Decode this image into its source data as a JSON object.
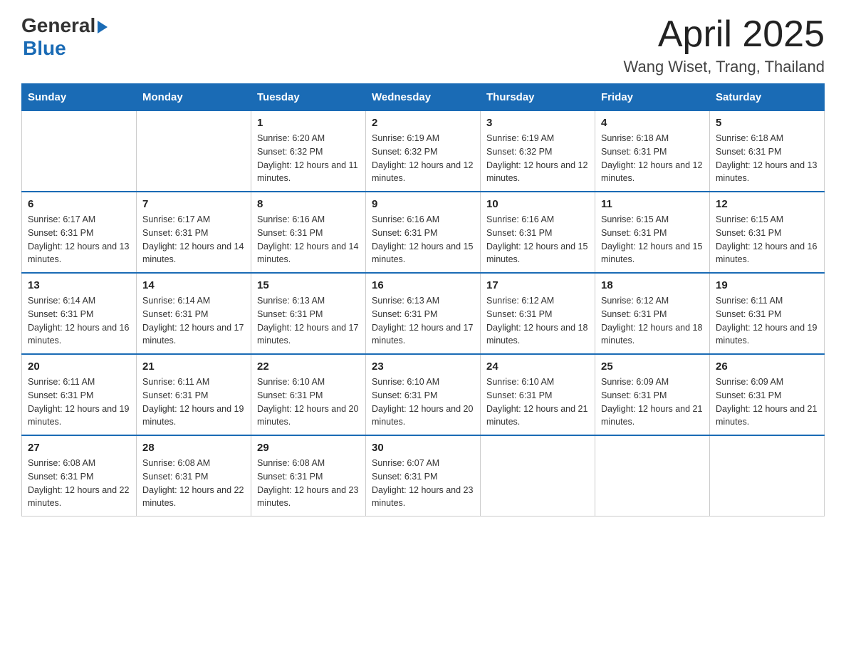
{
  "header": {
    "logo_general": "General",
    "logo_blue": "Blue",
    "month": "April 2025",
    "location": "Wang Wiset, Trang, Thailand"
  },
  "weekdays": [
    "Sunday",
    "Monday",
    "Tuesday",
    "Wednesday",
    "Thursday",
    "Friday",
    "Saturday"
  ],
  "weeks": [
    [
      {
        "day": "",
        "sunrise": "",
        "sunset": "",
        "daylight": ""
      },
      {
        "day": "",
        "sunrise": "",
        "sunset": "",
        "daylight": ""
      },
      {
        "day": "1",
        "sunrise": "Sunrise: 6:20 AM",
        "sunset": "Sunset: 6:32 PM",
        "daylight": "Daylight: 12 hours and 11 minutes."
      },
      {
        "day": "2",
        "sunrise": "Sunrise: 6:19 AM",
        "sunset": "Sunset: 6:32 PM",
        "daylight": "Daylight: 12 hours and 12 minutes."
      },
      {
        "day": "3",
        "sunrise": "Sunrise: 6:19 AM",
        "sunset": "Sunset: 6:32 PM",
        "daylight": "Daylight: 12 hours and 12 minutes."
      },
      {
        "day": "4",
        "sunrise": "Sunrise: 6:18 AM",
        "sunset": "Sunset: 6:31 PM",
        "daylight": "Daylight: 12 hours and 12 minutes."
      },
      {
        "day": "5",
        "sunrise": "Sunrise: 6:18 AM",
        "sunset": "Sunset: 6:31 PM",
        "daylight": "Daylight: 12 hours and 13 minutes."
      }
    ],
    [
      {
        "day": "6",
        "sunrise": "Sunrise: 6:17 AM",
        "sunset": "Sunset: 6:31 PM",
        "daylight": "Daylight: 12 hours and 13 minutes."
      },
      {
        "day": "7",
        "sunrise": "Sunrise: 6:17 AM",
        "sunset": "Sunset: 6:31 PM",
        "daylight": "Daylight: 12 hours and 14 minutes."
      },
      {
        "day": "8",
        "sunrise": "Sunrise: 6:16 AM",
        "sunset": "Sunset: 6:31 PM",
        "daylight": "Daylight: 12 hours and 14 minutes."
      },
      {
        "day": "9",
        "sunrise": "Sunrise: 6:16 AM",
        "sunset": "Sunset: 6:31 PM",
        "daylight": "Daylight: 12 hours and 15 minutes."
      },
      {
        "day": "10",
        "sunrise": "Sunrise: 6:16 AM",
        "sunset": "Sunset: 6:31 PM",
        "daylight": "Daylight: 12 hours and 15 minutes."
      },
      {
        "day": "11",
        "sunrise": "Sunrise: 6:15 AM",
        "sunset": "Sunset: 6:31 PM",
        "daylight": "Daylight: 12 hours and 15 minutes."
      },
      {
        "day": "12",
        "sunrise": "Sunrise: 6:15 AM",
        "sunset": "Sunset: 6:31 PM",
        "daylight": "Daylight: 12 hours and 16 minutes."
      }
    ],
    [
      {
        "day": "13",
        "sunrise": "Sunrise: 6:14 AM",
        "sunset": "Sunset: 6:31 PM",
        "daylight": "Daylight: 12 hours and 16 minutes."
      },
      {
        "day": "14",
        "sunrise": "Sunrise: 6:14 AM",
        "sunset": "Sunset: 6:31 PM",
        "daylight": "Daylight: 12 hours and 17 minutes."
      },
      {
        "day": "15",
        "sunrise": "Sunrise: 6:13 AM",
        "sunset": "Sunset: 6:31 PM",
        "daylight": "Daylight: 12 hours and 17 minutes."
      },
      {
        "day": "16",
        "sunrise": "Sunrise: 6:13 AM",
        "sunset": "Sunset: 6:31 PM",
        "daylight": "Daylight: 12 hours and 17 minutes."
      },
      {
        "day": "17",
        "sunrise": "Sunrise: 6:12 AM",
        "sunset": "Sunset: 6:31 PM",
        "daylight": "Daylight: 12 hours and 18 minutes."
      },
      {
        "day": "18",
        "sunrise": "Sunrise: 6:12 AM",
        "sunset": "Sunset: 6:31 PM",
        "daylight": "Daylight: 12 hours and 18 minutes."
      },
      {
        "day": "19",
        "sunrise": "Sunrise: 6:11 AM",
        "sunset": "Sunset: 6:31 PM",
        "daylight": "Daylight: 12 hours and 19 minutes."
      }
    ],
    [
      {
        "day": "20",
        "sunrise": "Sunrise: 6:11 AM",
        "sunset": "Sunset: 6:31 PM",
        "daylight": "Daylight: 12 hours and 19 minutes."
      },
      {
        "day": "21",
        "sunrise": "Sunrise: 6:11 AM",
        "sunset": "Sunset: 6:31 PM",
        "daylight": "Daylight: 12 hours and 19 minutes."
      },
      {
        "day": "22",
        "sunrise": "Sunrise: 6:10 AM",
        "sunset": "Sunset: 6:31 PM",
        "daylight": "Daylight: 12 hours and 20 minutes."
      },
      {
        "day": "23",
        "sunrise": "Sunrise: 6:10 AM",
        "sunset": "Sunset: 6:31 PM",
        "daylight": "Daylight: 12 hours and 20 minutes."
      },
      {
        "day": "24",
        "sunrise": "Sunrise: 6:10 AM",
        "sunset": "Sunset: 6:31 PM",
        "daylight": "Daylight: 12 hours and 21 minutes."
      },
      {
        "day": "25",
        "sunrise": "Sunrise: 6:09 AM",
        "sunset": "Sunset: 6:31 PM",
        "daylight": "Daylight: 12 hours and 21 minutes."
      },
      {
        "day": "26",
        "sunrise": "Sunrise: 6:09 AM",
        "sunset": "Sunset: 6:31 PM",
        "daylight": "Daylight: 12 hours and 21 minutes."
      }
    ],
    [
      {
        "day": "27",
        "sunrise": "Sunrise: 6:08 AM",
        "sunset": "Sunset: 6:31 PM",
        "daylight": "Daylight: 12 hours and 22 minutes."
      },
      {
        "day": "28",
        "sunrise": "Sunrise: 6:08 AM",
        "sunset": "Sunset: 6:31 PM",
        "daylight": "Daylight: 12 hours and 22 minutes."
      },
      {
        "day": "29",
        "sunrise": "Sunrise: 6:08 AM",
        "sunset": "Sunset: 6:31 PM",
        "daylight": "Daylight: 12 hours and 23 minutes."
      },
      {
        "day": "30",
        "sunrise": "Sunrise: 6:07 AM",
        "sunset": "Sunset: 6:31 PM",
        "daylight": "Daylight: 12 hours and 23 minutes."
      },
      {
        "day": "",
        "sunrise": "",
        "sunset": "",
        "daylight": ""
      },
      {
        "day": "",
        "sunrise": "",
        "sunset": "",
        "daylight": ""
      },
      {
        "day": "",
        "sunrise": "",
        "sunset": "",
        "daylight": ""
      }
    ]
  ]
}
